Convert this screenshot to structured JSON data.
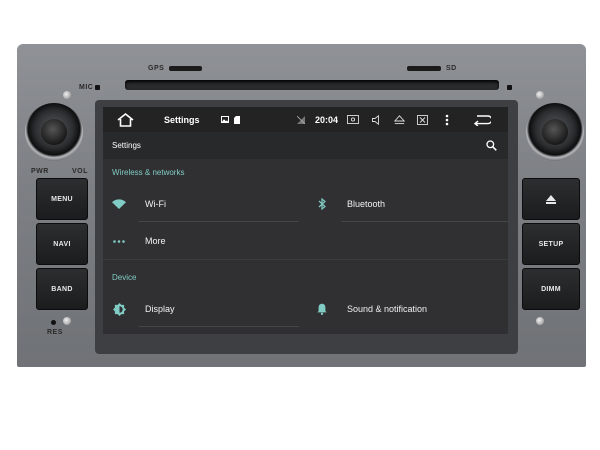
{
  "device": {
    "gps_label": "GPS",
    "sd_label": "SD",
    "mic_label": "MIC",
    "pwr_label": "PWR",
    "vol_label": "VOL",
    "res_label": "RES",
    "buttons_left": [
      "MENU",
      "NAVI",
      "BAND"
    ],
    "buttons_right": [
      "SETUP",
      "DIMM"
    ]
  },
  "statusbar": {
    "title": "Settings",
    "time": "20:04"
  },
  "toolbar": {
    "title": "Settings"
  },
  "sections": [
    {
      "title": "Wireless & networks",
      "items": [
        {
          "label": "Wi-Fi",
          "icon": "wifi-icon"
        },
        {
          "label": "Bluetooth",
          "icon": "bluetooth-icon"
        },
        {
          "label": "More",
          "icon": "more-dots-icon"
        }
      ]
    },
    {
      "title": "Device",
      "items": [
        {
          "label": "Display",
          "icon": "brightness-icon"
        },
        {
          "label": "Sound & notification",
          "icon": "bell-icon"
        }
      ]
    }
  ],
  "colors": {
    "accent": "#80cbc4",
    "screen_bg": "#303032",
    "statusbar_bg": "#232324"
  }
}
